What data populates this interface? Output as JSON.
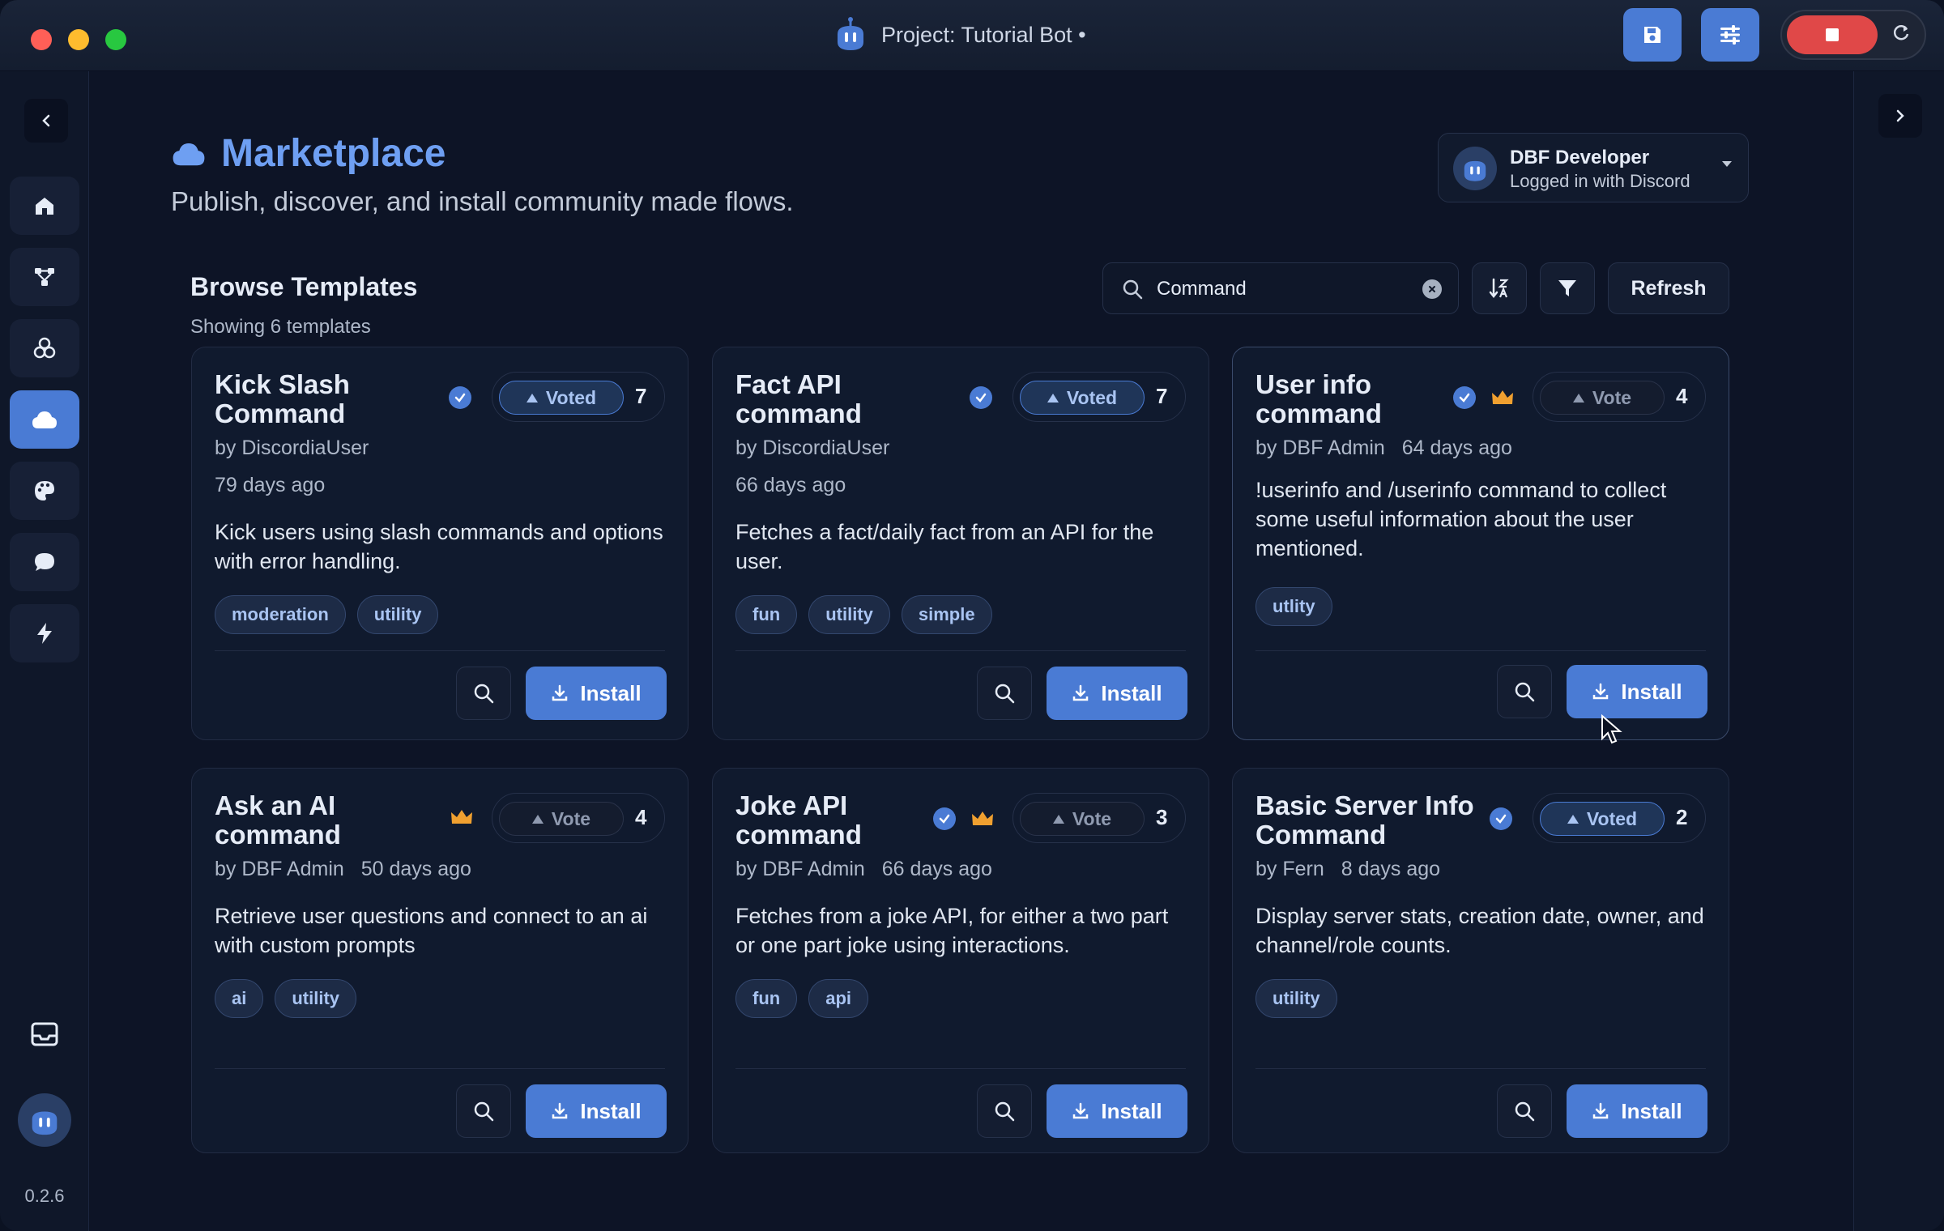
{
  "window": {
    "title": "Project: Tutorial Bot •"
  },
  "sidebar": {
    "items": [
      {
        "name": "home-icon",
        "active": false
      },
      {
        "name": "flows-icon",
        "active": false
      },
      {
        "name": "modules-icon",
        "active": false
      },
      {
        "name": "cloud-icon",
        "active": true
      },
      {
        "name": "palette-icon",
        "active": false
      },
      {
        "name": "chat-icon",
        "active": false
      },
      {
        "name": "bolt-icon",
        "active": false
      }
    ],
    "version": "0.2.6"
  },
  "header": {
    "title": "Marketplace",
    "subtitle": "Publish, discover, and install community made flows."
  },
  "user": {
    "name": "DBF Developer",
    "status": "Logged in with Discord"
  },
  "browse": {
    "title": "Browse Templates",
    "count_text": "Showing 6 templates",
    "search_value": "Command",
    "refresh_label": "Refresh"
  },
  "labels": {
    "voted": "Voted",
    "vote": "Vote",
    "install": "Install"
  },
  "cards": [
    {
      "title": "Kick Slash Command",
      "verified": true,
      "crown": false,
      "voted": true,
      "votes": "7",
      "author": "by DiscordiaUser",
      "date": "79 days ago",
      "description": "Kick users using slash commands and options with error handling.",
      "tags": [
        "moderation",
        "utility"
      ]
    },
    {
      "title": "Fact API command",
      "verified": true,
      "crown": false,
      "voted": true,
      "votes": "7",
      "author": "by DiscordiaUser",
      "date": "66 days ago",
      "description": "Fetches a fact/daily fact from an API for the user.",
      "tags": [
        "fun",
        "utility",
        "simple"
      ]
    },
    {
      "title": "User info command",
      "verified": true,
      "crown": true,
      "voted": false,
      "votes": "4",
      "author": "by DBF Admin",
      "date": "64 days ago",
      "description": "!userinfo and /userinfo command to collect some useful information about the user mentioned.",
      "tags": [
        "utlity"
      ]
    },
    {
      "title": "Ask an AI command",
      "verified": false,
      "crown": true,
      "voted": false,
      "votes": "4",
      "author": "by DBF Admin",
      "date": "50 days ago",
      "description": "Retrieve user questions and connect to an ai with custom prompts",
      "tags": [
        "ai",
        "utility"
      ]
    },
    {
      "title": "Joke API command",
      "verified": true,
      "crown": true,
      "voted": false,
      "votes": "3",
      "author": "by DBF Admin",
      "date": "66 days ago",
      "description": "Fetches from a joke API, for either a two part or one part joke using interactions.",
      "tags": [
        "fun",
        "api"
      ]
    },
    {
      "title": "Basic Server Info Command",
      "verified": true,
      "crown": false,
      "voted": true,
      "votes": "2",
      "author": "by Fern",
      "date": "8 days ago",
      "description": "Display server stats, creation date, owner, and channel/role counts.",
      "tags": [
        "utility"
      ]
    }
  ],
  "colors": {
    "accent": "#4a7bd4",
    "title_accent": "#6e9ff2",
    "stop": "#e04848",
    "crown": "#f0a030"
  }
}
